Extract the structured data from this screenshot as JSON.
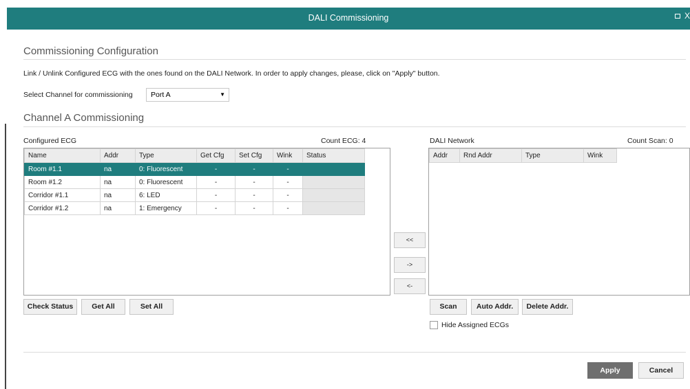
{
  "window": {
    "title": "DALI Commissioning",
    "max_icon": "maximize-icon",
    "close_glyph": "X"
  },
  "config": {
    "heading": "Commissioning Configuration",
    "description": "Link / Unlink Configured ECG with the ones found on the DALI Network. In order to apply changes, please, click on \"Apply\" button.",
    "channel_label": "Select Channel for commissioning",
    "channel_value": "Port A"
  },
  "channel": {
    "heading": "Channel A Commissioning",
    "configured": {
      "title": "Configured ECG",
      "count": "Count ECG: 4",
      "columns": [
        "Name",
        "Addr",
        "Type",
        "Get Cfg",
        "Set Cfg",
        "Wink",
        "Status"
      ],
      "rows": [
        [
          "Room #1.1",
          "na",
          "0: Fluorescent",
          "-",
          "-",
          "-",
          ""
        ],
        [
          "Room #1.2",
          "na",
          "0: Fluorescent",
          "-",
          "-",
          "-",
          ""
        ],
        [
          "Corridor #1.1",
          "na",
          "6: LED",
          "-",
          "-",
          "-",
          ""
        ],
        [
          "Corridor #1.2",
          "na",
          "1: Emergency",
          "-",
          "-",
          "-",
          ""
        ]
      ],
      "buttons": {
        "check_status": "Check Status",
        "get_all": "Get All",
        "set_all": "Set All"
      }
    },
    "middle": {
      "link_all": "<<",
      "link": "->",
      "unlink": "<-"
    },
    "network": {
      "title": "DALI Network",
      "count": "Count Scan: 0",
      "columns": [
        "Addr",
        "Rnd Addr",
        "Type",
        "Wink"
      ],
      "buttons": {
        "scan": "Scan",
        "auto_addr": "Auto Addr.",
        "delete_addr": "Delete Addr."
      },
      "hide_assigned": "Hide Assigned ECGs"
    }
  },
  "footer": {
    "apply": "Apply",
    "cancel": "Cancel"
  },
  "colors": {
    "accent": "#1f7d7e",
    "apply_bg": "#6f6f6f"
  }
}
